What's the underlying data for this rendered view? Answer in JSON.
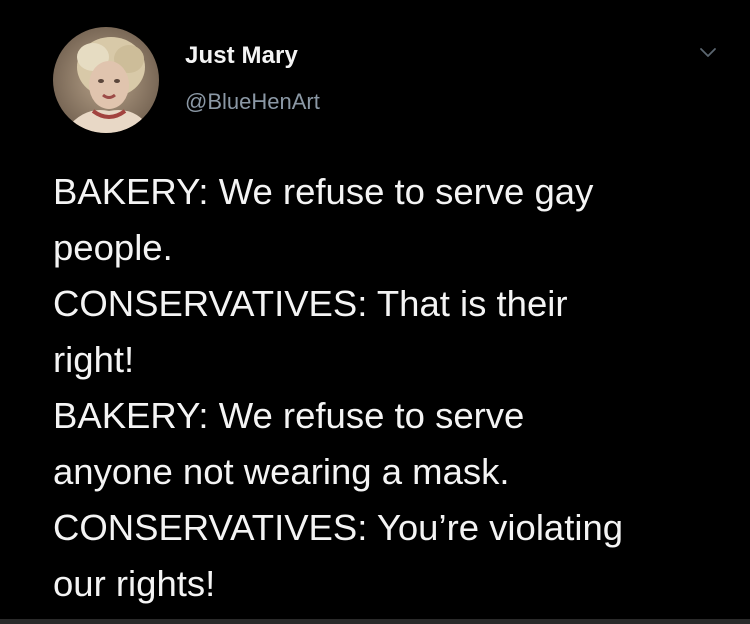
{
  "tweet": {
    "author": {
      "display_name": "Just Mary",
      "handle": "@BlueHenArt",
      "avatar_icon": "profile-photo"
    },
    "menu_icon": "chevron-down-icon",
    "lines": [
      "BAKERY: We refuse to serve gay",
      "people.",
      "CONSERVATIVES: That is their",
      "right!",
      "BAKERY: We refuse to serve",
      "anyone not wearing a mask.",
      "CONSERVATIVES: You’re violating",
      "our rights!"
    ]
  },
  "colors": {
    "background": "#000000",
    "text": "#f4f4f4",
    "handle": "#8b98a5",
    "caret": "#5b6670"
  }
}
